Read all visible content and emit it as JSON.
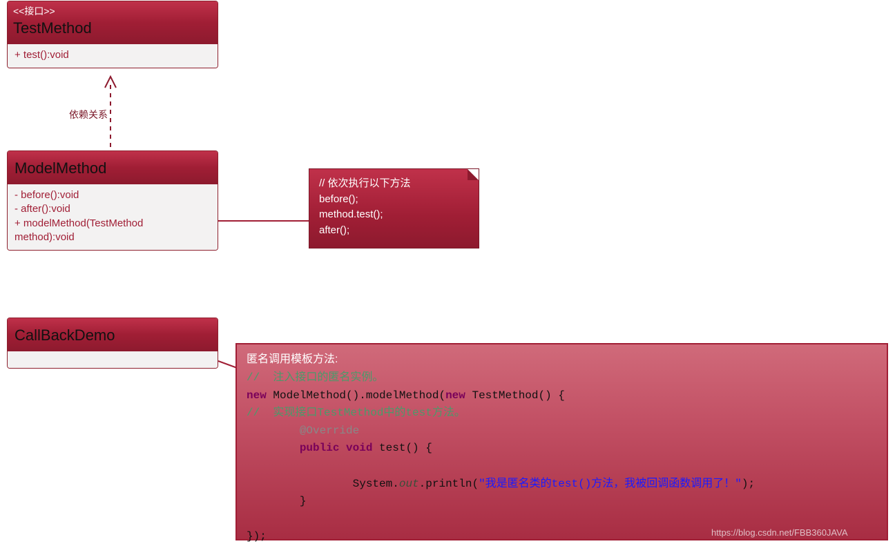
{
  "interface": {
    "stereotype": "<<接口>>",
    "name": "TestMethod",
    "methods": "+ test():void"
  },
  "class_model": {
    "name": "ModelMethod",
    "methods_line1": "- before():void",
    "methods_line2": "- after():void",
    "methods_line3": "+ modelMethod(TestMethod method):void"
  },
  "class_demo": {
    "name": "CallBackDemo"
  },
  "relation_label": "依赖关系",
  "note1": {
    "line1": "// 依次执行以下方法",
    "line2": "before();",
    "line3": "method.test();",
    "line4": "after();"
  },
  "note2": {
    "title": "匿名调用模板方法:",
    "l1": "//  注入接口的匿名实例。",
    "l2a": "new",
    "l2b": " ModelMethod().modelMethod(",
    "l2c": "new",
    "l2d": " TestMethod() {",
    "l3": "//  实现接口TestMethod中的test方法。",
    "l4": "        @Override",
    "l5a": "        public void",
    "l5b": " test() {",
    "l6": " ",
    "l7a": "                System.",
    "l7b": "out",
    "l7c": ".println(",
    "l7d": "\"我是匿名类的test()方法，我被回调函数调用了！\"",
    "l7e": ");",
    "l8": "        }",
    "l9": " ",
    "l10": "});"
  },
  "watermark": "https://blog.csdn.net/FBB360JAVA"
}
